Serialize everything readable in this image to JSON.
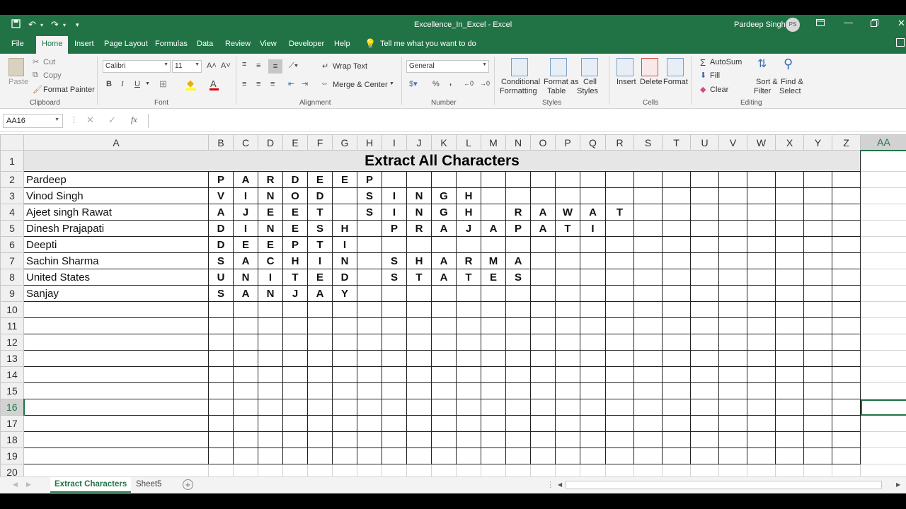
{
  "window": {
    "title": "Excellence_In_Excel  -  Excel",
    "user_name": "Pardeep Singh",
    "user_initials": "PS"
  },
  "ribbon_tabs": [
    "File",
    "Home",
    "Insert",
    "Page Layout",
    "Formulas",
    "Data",
    "Review",
    "View",
    "Developer",
    "Help"
  ],
  "tell_me": "Tell me what you want to do",
  "clipboard": {
    "paste": "Paste",
    "cut": "Cut",
    "copy": "Copy",
    "format_painter": "Format Painter",
    "label": "Clipboard"
  },
  "font": {
    "family": "Calibri",
    "size": "11",
    "bold": "B",
    "italic": "I",
    "underline": "U",
    "label": "Font"
  },
  "alignment": {
    "wrap_text": "Wrap Text",
    "merge_center": "Merge & Center",
    "label": "Alignment"
  },
  "number": {
    "format": "General",
    "percent": "%",
    "comma": ",",
    "label": "Number"
  },
  "styles": {
    "conditional": [
      "Conditional",
      "Formatting"
    ],
    "format_table": [
      "Format as",
      "Table"
    ],
    "cell_styles": [
      "Cell",
      "Styles"
    ],
    "label": "Styles"
  },
  "cells": {
    "insert": "Insert",
    "delete": "Delete",
    "format": "Format",
    "label": "Cells"
  },
  "editing": {
    "autosum": "AutoSum",
    "fill": "Fill",
    "clear": "Clear",
    "sort_filter": [
      "Sort &",
      "Filter"
    ],
    "find_select": [
      "Find &",
      "Select"
    ],
    "label": "Editing"
  },
  "formula_bar": {
    "name_box": "AA16",
    "fx": "fx",
    "value": ""
  },
  "columns": [
    "A",
    "B",
    "C",
    "D",
    "E",
    "F",
    "G",
    "H",
    "I",
    "J",
    "K",
    "L",
    "M",
    "N",
    "O",
    "P",
    "Q",
    "R",
    "S",
    "T",
    "U",
    "V",
    "W",
    "X",
    "Y",
    "Z",
    "AA"
  ],
  "selected_column": "AA",
  "selected_row": 16,
  "sheet_title": "Extract All Characters",
  "rows": [
    {
      "name": "Pardeep",
      "chars": [
        "P",
        "A",
        "R",
        "D",
        "E",
        "E",
        "P",
        "",
        "",
        "",
        "",
        "",
        "",
        "",
        "",
        "",
        "",
        "",
        "",
        "",
        "",
        "",
        "",
        "",
        ""
      ]
    },
    {
      "name": "Vinod Singh",
      "chars": [
        "V",
        "I",
        "N",
        "O",
        "D",
        "",
        "S",
        "I",
        "N",
        "G",
        "H",
        "",
        "",
        "",
        "",
        "",
        "",
        "",
        "",
        "",
        "",
        "",
        "",
        "",
        ""
      ]
    },
    {
      "name": "Ajeet singh Rawat",
      "chars": [
        "A",
        "J",
        "E",
        "E",
        "T",
        "",
        "S",
        "I",
        "N",
        "G",
        "H",
        "",
        "R",
        "A",
        "W",
        "A",
        "T",
        "",
        "",
        "",
        "",
        "",
        "",
        "",
        ""
      ]
    },
    {
      "name": "Dinesh Prajapati",
      "chars": [
        "D",
        "I",
        "N",
        "E",
        "S",
        "H",
        "",
        "P",
        "R",
        "A",
        "J",
        "A",
        "P",
        "A",
        "T",
        "I",
        "",
        "",
        "",
        "",
        "",
        "",
        "",
        "",
        ""
      ]
    },
    {
      "name": "Deepti",
      "chars": [
        "D",
        "E",
        "E",
        "P",
        "T",
        "I",
        "",
        "",
        "",
        "",
        "",
        "",
        "",
        "",
        "",
        "",
        "",
        "",
        "",
        "",
        "",
        "",
        "",
        "",
        ""
      ]
    },
    {
      "name": "Sachin Sharma",
      "chars": [
        "S",
        "A",
        "C",
        "H",
        "I",
        "N",
        "",
        "S",
        "H",
        "A",
        "R",
        "M",
        "A",
        "",
        "",
        "",
        "",
        "",
        "",
        "",
        "",
        "",
        "",
        "",
        ""
      ]
    },
    {
      "name": "United States",
      "chars": [
        "U",
        "N",
        "I",
        "T",
        "E",
        "D",
        "",
        "S",
        "T",
        "A",
        "T",
        "E",
        "S",
        "",
        "",
        "",
        "",
        "",
        "",
        "",
        "",
        "",
        "",
        "",
        ""
      ]
    },
    {
      "name": "Sanjay",
      "chars": [
        "S",
        "A",
        "N",
        "J",
        "A",
        "Y",
        "",
        "",
        "",
        "",
        "",
        "",
        "",
        "",
        "",
        "",
        "",
        "",
        "",
        "",
        "",
        "",
        "",
        "",
        ""
      ]
    }
  ],
  "row_numbers": [
    1,
    2,
    3,
    4,
    5,
    6,
    7,
    8,
    9,
    10,
    11,
    12,
    13,
    14,
    15,
    16,
    17,
    18,
    19,
    20
  ],
  "sheets": [
    {
      "name": "Extract Characters",
      "active": true
    },
    {
      "name": "Sheet5",
      "active": false
    }
  ],
  "colors": {
    "accent": "#217346",
    "title_fill": "#e7e6e6"
  }
}
